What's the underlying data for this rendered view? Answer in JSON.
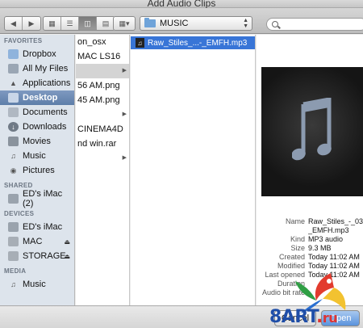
{
  "window": {
    "title": "Add Audio Clips"
  },
  "toolbar": {
    "back_icon": "chevron-left-icon",
    "forward_icon": "chevron-right-icon",
    "view_modes": [
      "icon-view",
      "list-view",
      "column-view",
      "cover-flow-view"
    ],
    "active_view": "column-view",
    "arrange_icon": "grid-arrange-icon",
    "path_folder": "MUSIC",
    "search_placeholder": ""
  },
  "sidebar": {
    "sections": [
      {
        "label": "FAVORITES",
        "items": [
          {
            "label": "Dropbox",
            "icon": "folder-icon"
          },
          {
            "label": "All My Files",
            "icon": "all-files-icon"
          },
          {
            "label": "Applications",
            "icon": "applications-icon"
          },
          {
            "label": "Desktop",
            "icon": "desktop-icon",
            "selected": true
          },
          {
            "label": "Documents",
            "icon": "documents-icon"
          },
          {
            "label": "Downloads",
            "icon": "downloads-icon"
          },
          {
            "label": "Movies",
            "icon": "movies-icon"
          },
          {
            "label": "Music",
            "icon": "music-icon"
          },
          {
            "label": "Pictures",
            "icon": "pictures-icon"
          }
        ]
      },
      {
        "label": "SHARED",
        "items": [
          {
            "label": "ED's iMac (2)",
            "icon": "computer-icon"
          }
        ]
      },
      {
        "label": "DEVICES",
        "items": [
          {
            "label": "ED's iMac",
            "icon": "computer-icon"
          },
          {
            "label": "MAC",
            "icon": "drive-icon",
            "eject": true
          },
          {
            "label": "STORAGE",
            "icon": "drive-icon",
            "eject": true
          }
        ]
      },
      {
        "label": "MEDIA",
        "items": [
          {
            "label": "Music",
            "icon": "music-icon"
          }
        ]
      }
    ]
  },
  "column1": {
    "rows": [
      "on_osx",
      "MAC LS16",
      "",
      "56 AM.png",
      "45 AM.png",
      "",
      "CINEMA4D",
      "nd win.rar"
    ]
  },
  "column2": {
    "file": "Raw_Stiles_...-_EMFH.mp3"
  },
  "preview": {
    "meta": [
      {
        "k": "Name",
        "v": "Raw_Stiles_-_03"
      },
      {
        "k": "",
        "v": "_EMFH.mp3"
      },
      {
        "k": "Kind",
        "v": "MP3 audio"
      },
      {
        "k": "Size",
        "v": "9.3 MB"
      },
      {
        "k": "Created",
        "v": "Today 11:02 AM"
      },
      {
        "k": "Modified",
        "v": "Today 11:02 AM"
      },
      {
        "k": "Last opened",
        "v": "Today 11:02 AM"
      },
      {
        "k": "Duration",
        "v": ""
      },
      {
        "k": "Audio bit rate",
        "v": ""
      }
    ]
  },
  "buttons": {
    "cancel": "Cancel",
    "open": "Open"
  },
  "watermark": {
    "brand": "8ART",
    "dot": ".",
    "tld": "ru"
  },
  "colors": {
    "selection": "#3875d7",
    "sidebar": "#dde4ec",
    "sidebar_selected": "#5e7ea9"
  }
}
